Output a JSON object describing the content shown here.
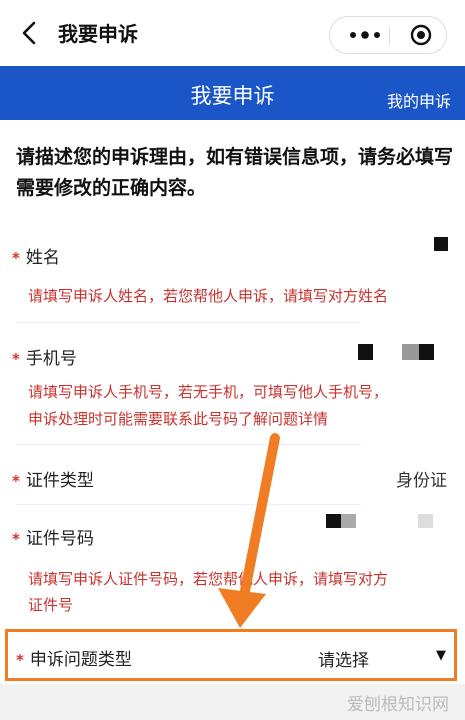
{
  "nav": {
    "title": "我要申诉"
  },
  "header": {
    "title": "我要申诉",
    "my_appeal": "我的申诉"
  },
  "intro": "请描述您的申诉理由，如有错误信息项，请务必填写需要修改的正确内容。",
  "fields": {
    "name": {
      "label": "姓名",
      "hint": "请填写申诉人姓名，若您帮他人申诉，请填写对方姓名"
    },
    "phone": {
      "label": "手机号",
      "hint1": "请填写申诉人手机号，若无手机，可填写他人手机号，",
      "hint2": "申诉处理时可能需要联系此号码了解问题详情"
    },
    "id_type": {
      "label": "证件类型",
      "value": "身份证"
    },
    "id_number": {
      "label": "证件号码",
      "hint1": "请填写申诉人证件号码，若您帮他人申诉，请填写对方",
      "hint2": "证件号"
    },
    "issue_type": {
      "label": "申诉问题类型",
      "value": "请选择"
    }
  },
  "required_mark": "*",
  "watermark": "爱刨根知识网",
  "colors": {
    "header_blue": "#1a56c8",
    "hint_red": "#c8332f",
    "highlight_orange": "#f07d24"
  }
}
